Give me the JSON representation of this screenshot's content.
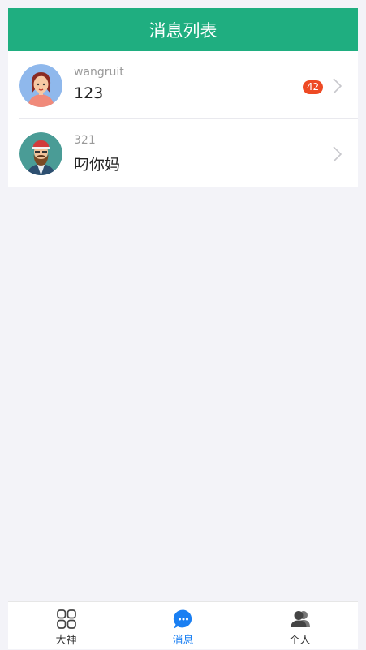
{
  "header": {
    "title": "消息列表"
  },
  "conversations": [
    {
      "name": "wangruit",
      "message": "123",
      "badge": "42",
      "avatar": "woman-avatar"
    },
    {
      "name": "321",
      "message": "叼你妈",
      "badge": "",
      "avatar": "bearded-man-avatar"
    }
  ],
  "tabs": [
    {
      "label": "大神",
      "icon": "grid-icon",
      "active": false
    },
    {
      "label": "消息",
      "icon": "chat-bubble-icon",
      "active": true
    },
    {
      "label": "个人",
      "icon": "people-icon",
      "active": false
    }
  ],
  "colors": {
    "header": "#1fae80",
    "badge": "#ee4a24",
    "active_tab": "#1a7ff2",
    "background": "#f3f3f8"
  }
}
